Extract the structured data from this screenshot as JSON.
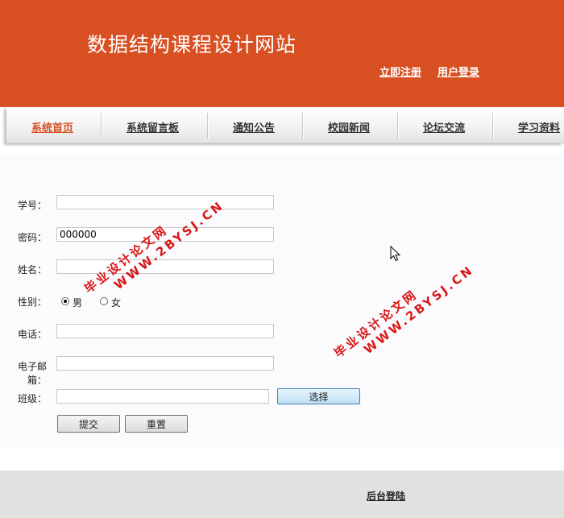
{
  "header": {
    "title": "数据结构课程设计网站",
    "links": [
      "立即注册",
      "用户登录"
    ]
  },
  "nav": {
    "items": [
      "系统首页",
      "系统留言板",
      "通知公告",
      "校园新闻",
      "论坛交流",
      "学习资料"
    ],
    "active_index": 0
  },
  "form": {
    "student_id": {
      "label": "学号：",
      "value": ""
    },
    "password": {
      "label": "密码：",
      "value": "000000"
    },
    "name": {
      "label": "姓名：",
      "value": ""
    },
    "gender": {
      "label": "性别：",
      "options": [
        "男",
        "女"
      ],
      "selected": "男"
    },
    "phone": {
      "label": "电话：",
      "value": ""
    },
    "email": {
      "label": "电子邮箱：",
      "value": ""
    },
    "class": {
      "label": "班级：",
      "value": "",
      "choose_button": "选择"
    },
    "submit_label": "提交",
    "reset_label": "重置"
  },
  "footer": {
    "admin_login": "后台登陆"
  },
  "watermarks": [
    {
      "line1": "毕业设计论文网",
      "line2": "WWW.2BYSJ.CN"
    },
    {
      "line1": "毕业设计论文网",
      "line2": "WWW.2BYSJ.CN"
    }
  ],
  "colors": {
    "brand": "#d84f22",
    "watermark": "#d81818",
    "footer_bg": "#e1e1e1"
  }
}
